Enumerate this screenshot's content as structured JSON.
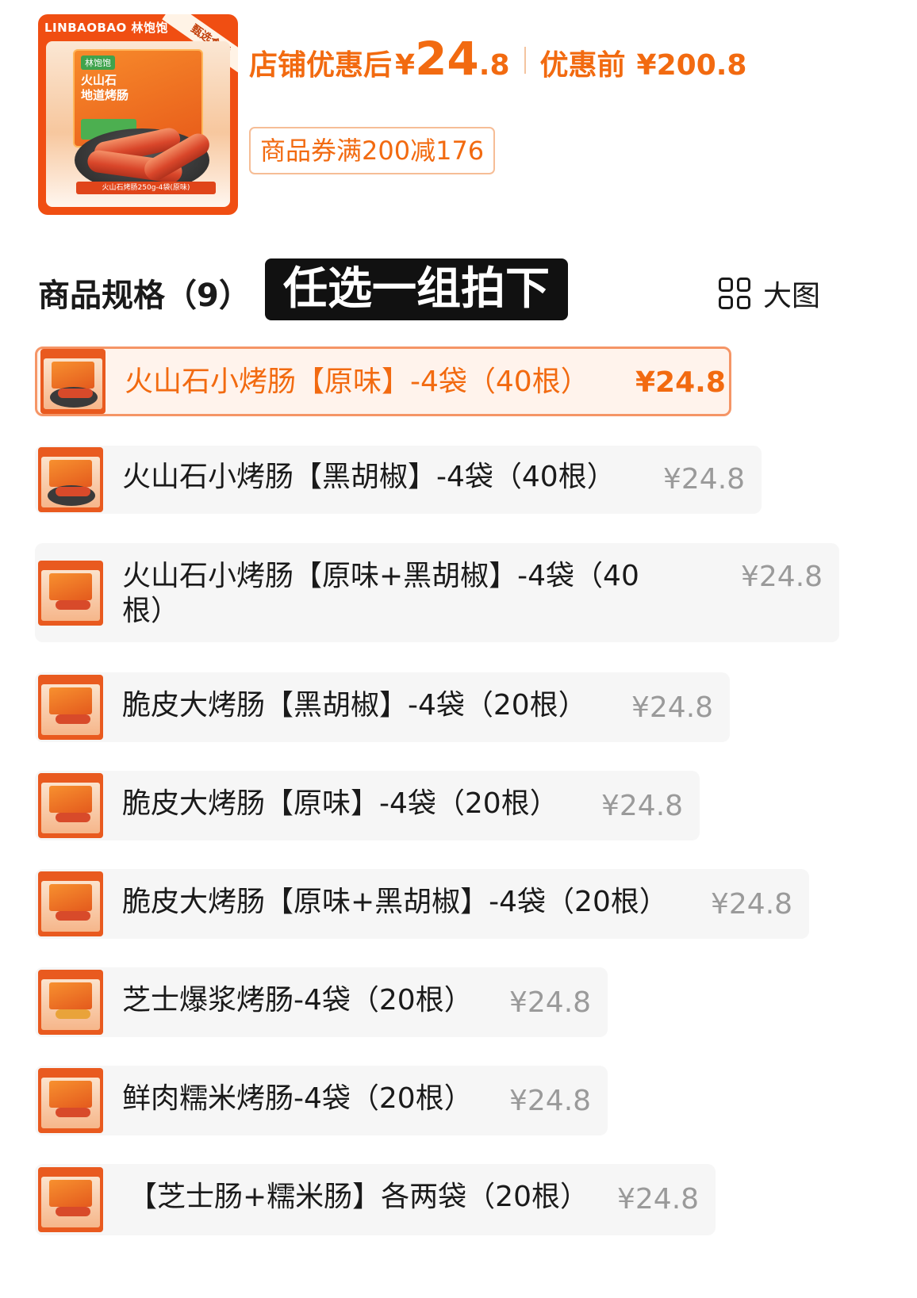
{
  "product": {
    "brand": "LINBAOBAO 林饱饱",
    "ribbon": "甄选食材",
    "pack_tag": "林饱饱",
    "pack_title_1": "火山石",
    "pack_title_2": "地道烤肠",
    "caption": "火山石烤肠250g-4袋(原味)"
  },
  "price": {
    "after_label": "店铺优惠后",
    "currency": "¥",
    "after_int": "24",
    "after_dec": ".8",
    "before_label": "优惠前",
    "before_value": "¥200.8"
  },
  "coupon": {
    "label": "商品券满200减176"
  },
  "spec": {
    "title": "商品规格（9）",
    "badge": "任选一组拍下",
    "bigview_label": "大图"
  },
  "options": [
    {
      "name": "火山石小烤肠【原味】-4袋（40根）",
      "price": "¥24.8",
      "selected": true
    },
    {
      "name": "火山石小烤肠【黑胡椒】-4袋（40根）",
      "price": "¥24.8"
    },
    {
      "name": "火山石小烤肠【原味+黑胡椒】-4袋（40根）",
      "price": "¥24.8"
    },
    {
      "name": "脆皮大烤肠【黑胡椒】-4袋（20根）",
      "price": "¥24.8"
    },
    {
      "name": "脆皮大烤肠【原味】-4袋（20根）",
      "price": "¥24.8"
    },
    {
      "name": "脆皮大烤肠【原味+黑胡椒】-4袋（20根）",
      "price": "¥24.8"
    },
    {
      "name": "芝士爆浆烤肠-4袋（20根）",
      "price": "¥24.8"
    },
    {
      "name": "鲜肉糯米烤肠-4袋（20根）",
      "price": "¥24.8"
    },
    {
      "name": "【芝士肠+糯米肠】各两袋（20根）",
      "price": "¥24.8"
    }
  ],
  "colors": {
    "accent": "#f26a10",
    "selected_bg": "#fff3ec",
    "selected_border": "#f59566",
    "option_bg": "#f6f6f6",
    "muted_price": "#9a9a9a"
  }
}
